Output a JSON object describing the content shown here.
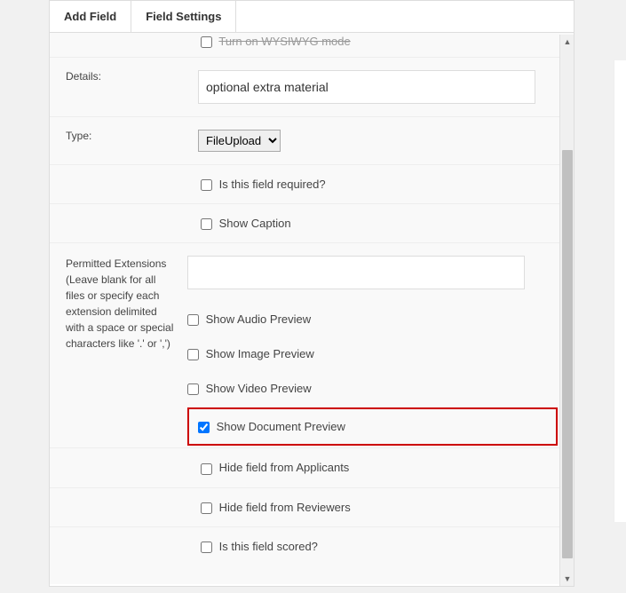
{
  "tabs": {
    "addField": "Add Field",
    "fieldSettings": "Field Settings"
  },
  "truncated": {
    "wysiwygModeLabel": "Turn on WYSIWYG mode"
  },
  "details": {
    "label": "Details:",
    "value": "optional extra material"
  },
  "type": {
    "label": "Type:",
    "selected": "FileUpload",
    "options": [
      "FileUpload"
    ]
  },
  "checkboxes": {
    "required": {
      "label": "Is this field required?",
      "checked": false
    },
    "showCaption": {
      "label": "Show Caption",
      "checked": false
    },
    "showAudio": {
      "label": "Show Audio Preview",
      "checked": false
    },
    "showImage": {
      "label": "Show Image Preview",
      "checked": false
    },
    "showVideo": {
      "label": "Show Video Preview",
      "checked": false
    },
    "showDocument": {
      "label": "Show Document Preview",
      "checked": true,
      "highlighted": true
    },
    "hideApplicants": {
      "label": "Hide field from Applicants",
      "checked": false
    },
    "hideReviewers": {
      "label": "Hide field from Reviewers",
      "checked": false
    },
    "scored": {
      "label": "Is this field scored?",
      "checked": false
    }
  },
  "permittedExtensions": {
    "label": "Permitted Extensions (Leave blank for all files or specify each extension delimited with a space or special characters like '.' or ',')",
    "value": ""
  }
}
